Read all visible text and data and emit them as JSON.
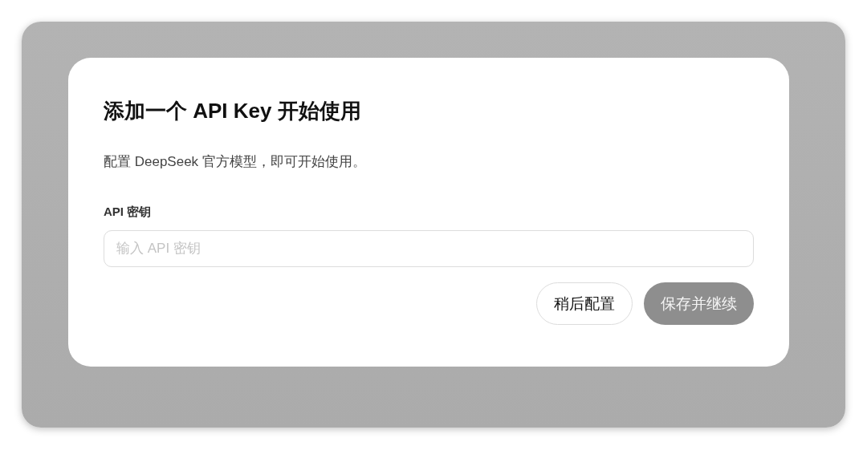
{
  "dialog": {
    "title": "添加一个 API Key 开始使用",
    "description": "配置 DeepSeek 官方模型，即可开始使用。",
    "field": {
      "label": "API 密钥",
      "placeholder": "输入 API 密钥"
    },
    "buttons": [
      {
        "label": "稍后配置",
        "kind": "secondary",
        "disabled": false
      },
      {
        "label": "保存并继续",
        "kind": "primary",
        "disabled": true
      }
    ]
  }
}
